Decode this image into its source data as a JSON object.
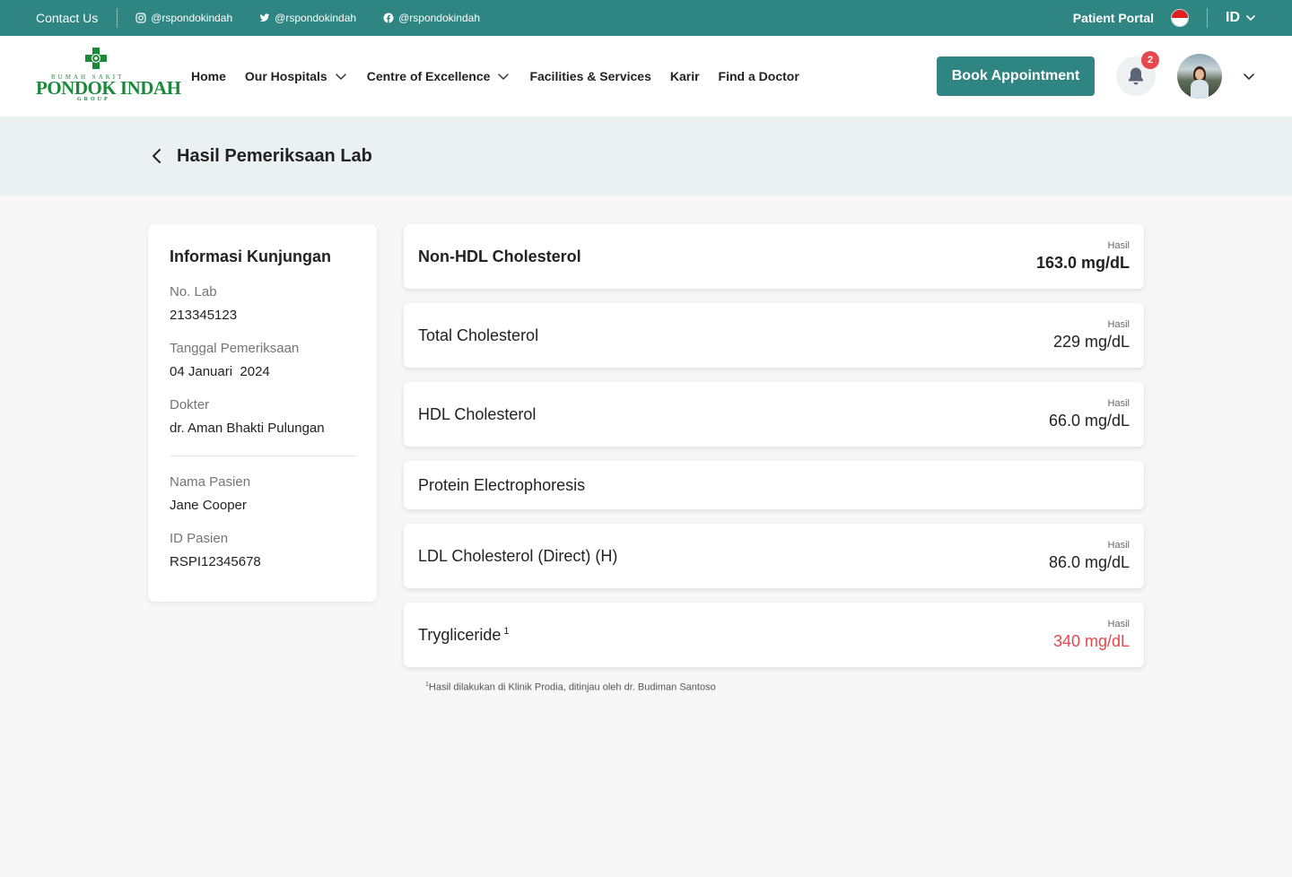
{
  "topbar": {
    "contact": "Contact Us",
    "socials": [
      {
        "icon": "instagram-icon",
        "handle": "@rspondokindah"
      },
      {
        "icon": "twitter-icon",
        "handle": "@rspondokindah"
      },
      {
        "icon": "facebook-icon",
        "handle": "@rspondokindah"
      }
    ],
    "portal": "Patient Portal",
    "language": "ID",
    "accent_color": "#2f8582"
  },
  "logo": {
    "line1": "RUMAH SAKIT",
    "line2": "PONDOK INDAH",
    "line3": "GROUP",
    "color": "#1a8a3a"
  },
  "nav": {
    "items": [
      {
        "label": "Home"
      },
      {
        "label": "Our Hospitals",
        "dropdown": true
      },
      {
        "label": "Centre of Excellence",
        "dropdown": true
      },
      {
        "label": "Facilities & Services"
      },
      {
        "label": "Karir"
      },
      {
        "label": "Find a Doctor"
      }
    ],
    "book_label": "Book Appointment",
    "notification_count": "2"
  },
  "page": {
    "title": "Hasil Pemeriksaan Lab"
  },
  "visit": {
    "heading": "Informasi Kunjungan",
    "fields": [
      {
        "label": "No. Lab",
        "value": "213345123"
      },
      {
        "label": "Tanggal Pemeriksaan",
        "value": "04 Januari  2024"
      },
      {
        "label": "Dokter",
        "value": "dr. Aman Bhakti Pulungan"
      }
    ],
    "patient": [
      {
        "label": "Nama Pasien",
        "value": "Jane Cooper"
      },
      {
        "label": "ID Pasien",
        "value": "RSPI12345678"
      }
    ]
  },
  "results": [
    {
      "name": "Non-HDL Cholesterol",
      "label": "Hasil",
      "value": "163.0 mg/dL",
      "bold": true,
      "high": false
    },
    {
      "name": "Total Cholesterol",
      "label": "Hasil",
      "value": "229 mg/dL",
      "bold": false,
      "high": false
    },
    {
      "name": "HDL Cholesterol",
      "label": "Hasil",
      "value": "66.0 mg/dL",
      "bold": false,
      "high": false
    },
    {
      "name": "Protein Electrophoresis"
    },
    {
      "name": "LDL Cholesterol (Direct) (H)",
      "label": "Hasil",
      "value": "86.0 mg/dL",
      "bold": false,
      "high": false
    },
    {
      "name": "Trygliceride",
      "sup": "1",
      "label": "Hasil",
      "value": "340 mg/dL",
      "bold": false,
      "high": true
    }
  ],
  "footnote": {
    "sup": "1",
    "text": "Hasil dilakukan di Klinik Prodia, ditinjau oleh dr. Budiman Santoso"
  },
  "colors": {
    "high_value": "#e5484d",
    "badge": "#e5484d"
  }
}
